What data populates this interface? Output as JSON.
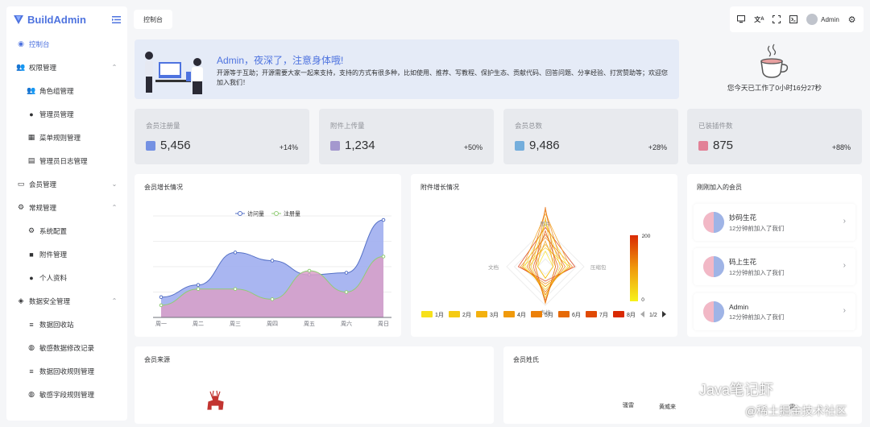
{
  "app": {
    "name": "BuildAdmin"
  },
  "tab": {
    "label": "控制台"
  },
  "topbar": {
    "user": "Admin"
  },
  "sidebar": {
    "items": [
      {
        "label": "控制台",
        "level": 0,
        "active": true,
        "icon": "dashboard-icon"
      },
      {
        "label": "权限管理",
        "level": 0,
        "expand": true,
        "icon": "group-icon"
      },
      {
        "label": "角色组管理",
        "level": 1,
        "icon": "group-icon"
      },
      {
        "label": "管理员管理",
        "level": 1,
        "icon": "user-icon"
      },
      {
        "label": "菜单规则管理",
        "level": 1,
        "icon": "grid-icon"
      },
      {
        "label": "管理员日志管理",
        "level": 1,
        "icon": "clipboard-icon"
      },
      {
        "label": "会员管理",
        "level": 0,
        "expand": false,
        "icon": "id-card-icon"
      },
      {
        "label": "常规管理",
        "level": 0,
        "expand": true,
        "icon": "cogs-icon"
      },
      {
        "label": "系统配置",
        "level": 1,
        "icon": "gear-icon"
      },
      {
        "label": "附件管理",
        "level": 1,
        "icon": "folder-icon"
      },
      {
        "label": "个人资料",
        "level": 1,
        "icon": "user-icon"
      },
      {
        "label": "数据安全管理",
        "level": 0,
        "expand": true,
        "icon": "shield-icon"
      },
      {
        "label": "数据回收站",
        "level": 1,
        "icon": "database-icon"
      },
      {
        "label": "敏感数据修改记录",
        "level": 1,
        "icon": "lock-icon"
      },
      {
        "label": "数据回收规则管理",
        "level": 1,
        "icon": "database-icon"
      },
      {
        "label": "敏感字段规则管理",
        "level": 1,
        "icon": "lock-icon"
      }
    ]
  },
  "welcome": {
    "title": "Admin，夜深了，注意身体哦!",
    "desc": "开源等于互助；开源需要大家一起来支持，支持的方式有很多种，比如使用、推荐、写教程、保护生态、贡献代码、回答问题、分享经验、打赏赞助等；欢迎您加入我们！",
    "work": "您今天已工作了0小时16分27秒"
  },
  "stats": [
    {
      "title": "会员注册量",
      "value": "5,456",
      "pct": "+14%",
      "color": "#4e73df",
      "pctColor": "#303133",
      "icon": "line-chart-icon"
    },
    {
      "title": "附件上传量",
      "value": "1,234",
      "pct": "+50%",
      "color": "#8e7cc3",
      "pctColor": "#303133",
      "icon": "file-icon"
    },
    {
      "title": "会员总数",
      "value": "9,486",
      "pct": "+28%",
      "color": "#4e9ad6",
      "pctColor": "#303133",
      "icon": "users-icon"
    },
    {
      "title": "已装插件数",
      "value": "875",
      "pct": "+88%",
      "color": "#e05d7a",
      "pctColor": "#303133",
      "icon": "plugin-icon"
    }
  ],
  "cards": {
    "growth": "会员增长情况",
    "attach": "附件增长情况",
    "recent": "刚刚加入的会员",
    "source": "会员来源",
    "surname": "会员姓氏"
  },
  "chart_data": [
    {
      "type": "area",
      "title": "会员增长情况",
      "categories": [
        "周一",
        "周二",
        "周三",
        "周四",
        "周五",
        "周六",
        "周日"
      ],
      "series": [
        {
          "name": "访问量",
          "color": "#5470c6",
          "fill": "#9aa9ee",
          "values": [
            100,
            160,
            320,
            280,
            210,
            220,
            480
          ]
        },
        {
          "name": "注册量",
          "color": "#91cc75",
          "fill": "#d9a0c8",
          "values": [
            60,
            140,
            140,
            90,
            230,
            125,
            300
          ]
        }
      ],
      "ylim": [
        0,
        500
      ],
      "legend": "top"
    },
    {
      "type": "radar",
      "title": "附件增长情况",
      "indicators": [
        "图片",
        "压缩包",
        "表格",
        "文档"
      ],
      "visual_map": {
        "min": 0,
        "max": 200
      },
      "months": [
        "1月",
        "2月",
        "3月",
        "4月",
        "5月",
        "6月",
        "7月",
        "8月"
      ],
      "month_colors": [
        "#f7e11b",
        "#f5cb14",
        "#f3b10f",
        "#f09a0c",
        "#ec8009",
        "#e66a07",
        "#e04a05",
        "#d92a03"
      ],
      "pager": "1/2"
    }
  ],
  "recent_members": [
    {
      "name": "妙码生花",
      "time": "12分钟前加入了我们"
    },
    {
      "name": "码上生花",
      "time": "12分钟前加入了我们"
    },
    {
      "name": "Admin",
      "time": "12分钟前加入了我们"
    }
  ],
  "surname_words": [
    "骚雷",
    "黄威来",
    "雷"
  ],
  "watermark": {
    "line1": "Java笔记虾",
    "line2": "@稀土掘金技术社区"
  }
}
